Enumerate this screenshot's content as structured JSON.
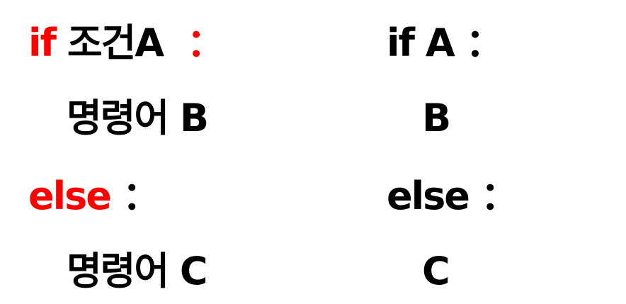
{
  "left": {
    "line1": {
      "keyword": "if",
      "condition": "조건A",
      "colon": "："
    },
    "line2": {
      "text": "명령어 B"
    },
    "line3": {
      "keyword": "else",
      "colon": "："
    },
    "line4": {
      "text": "명령어 C"
    }
  },
  "right": {
    "line1": {
      "keyword": "if",
      "condition": "A",
      "colon": "："
    },
    "line2": {
      "text": "B"
    },
    "line3": {
      "keyword": "else",
      "colon": "："
    },
    "line4": {
      "text": "C"
    }
  },
  "colors": {
    "keyword_left": "#ff0000",
    "text": "#000000",
    "background": "#ffffff"
  }
}
